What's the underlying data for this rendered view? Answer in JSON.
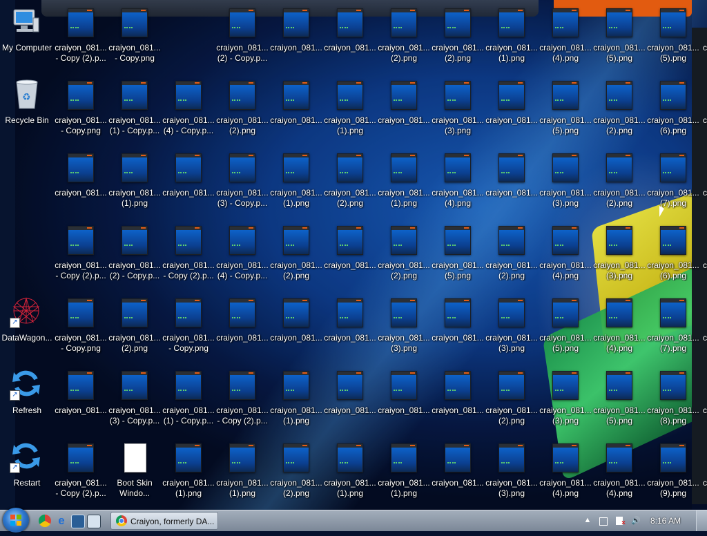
{
  "system_icons": [
    {
      "label": "My Computer"
    },
    {
      "label": "Recycle Bin"
    },
    {
      "label": "DataWagon..."
    },
    {
      "label": "Refresh"
    },
    {
      "label": "Restart"
    }
  ],
  "file_grid": [
    [
      [
        "craiyon_081...",
        "- Copy (2).p..."
      ],
      [
        "craiyon_081...",
        "- Copy.png"
      ],
      null,
      [
        "craiyon_081...",
        "(2) - Copy.p..."
      ],
      [
        "craiyon_081..."
      ],
      [
        "craiyon_081..."
      ],
      [
        "craiyon_081...",
        "(2).png"
      ],
      [
        "craiyon_081...",
        "(2).png"
      ],
      [
        "craiyon_081...",
        "(1).png"
      ],
      [
        "craiyon_081...",
        "(4).png"
      ],
      [
        "craiyon_081...",
        "(5).png"
      ],
      [
        "craiyon_081...",
        "(5).png"
      ]
    ],
    [
      [
        "craiyon_081...",
        "- Copy.png"
      ],
      [
        "craiyon_081...",
        "(1) - Copy.p..."
      ],
      [
        "craiyon_081...",
        "(4) - Copy.p..."
      ],
      [
        "craiyon_081...",
        "(2).png"
      ],
      [
        "craiyon_081..."
      ],
      [
        "craiyon_081...",
        "(1).png"
      ],
      [
        "craiyon_081..."
      ],
      [
        "craiyon_081...",
        "(3).png"
      ],
      [
        "craiyon_081..."
      ],
      [
        "craiyon_081...",
        "(5).png"
      ],
      [
        "craiyon_081...",
        "(2).png"
      ],
      [
        "craiyon_081...",
        "(6).png"
      ]
    ],
    [
      [
        "craiyon_081..."
      ],
      [
        "craiyon_081...",
        "(1).png"
      ],
      [
        "craiyon_081..."
      ],
      [
        "craiyon_081...",
        "(3) - Copy.p..."
      ],
      [
        "craiyon_081...",
        "(1).png"
      ],
      [
        "craiyon_081...",
        "(2).png"
      ],
      [
        "craiyon_081...",
        "(1).png"
      ],
      [
        "craiyon_081...",
        "(4).png"
      ],
      [
        "craiyon_081..."
      ],
      [
        "craiyon_081...",
        "(3).png"
      ],
      [
        "craiyon_081...",
        "(2).png"
      ],
      [
        "craiyon_081...",
        "(7).png"
      ]
    ],
    [
      [
        "craiyon_081...",
        "- Copy (2).p..."
      ],
      [
        "craiyon_081...",
        "(2) - Copy.p..."
      ],
      [
        "craiyon_081...",
        "- Copy (2).p..."
      ],
      [
        "craiyon_081...",
        "(4) - Copy.p..."
      ],
      [
        "craiyon_081...",
        "(2).png"
      ],
      [
        "craiyon_081..."
      ],
      [
        "craiyon_081...",
        "(2).png"
      ],
      [
        "craiyon_081...",
        "(5).png"
      ],
      [
        "craiyon_081...",
        "(2).png"
      ],
      [
        "craiyon_081...",
        "(4).png"
      ],
      [
        "craiyon_081...",
        "(3).png"
      ],
      [
        "craiyon_081...",
        "(6).png"
      ]
    ],
    [
      [
        "craiyon_081...",
        "- Copy.png"
      ],
      [
        "craiyon_081...",
        "(2).png"
      ],
      [
        "craiyon_081...",
        "- Copy.png"
      ],
      [
        "craiyon_081..."
      ],
      [
        "craiyon_081..."
      ],
      [
        "craiyon_081..."
      ],
      [
        "craiyon_081...",
        "(3).png"
      ],
      [
        "craiyon_081..."
      ],
      [
        "craiyon_081...",
        "(3).png"
      ],
      [
        "craiyon_081...",
        "(5).png"
      ],
      [
        "craiyon_081...",
        "(4).png"
      ],
      [
        "craiyon_081...",
        "(7).png"
      ]
    ],
    [
      [
        "craiyon_081..."
      ],
      [
        "craiyon_081...",
        "(3) - Copy.p..."
      ],
      [
        "craiyon_081...",
        "(1) - Copy.p..."
      ],
      [
        "craiyon_081...",
        "- Copy (2).p..."
      ],
      [
        "craiyon_081...",
        "(1).png"
      ],
      [
        "craiyon_081..."
      ],
      [
        "craiyon_081..."
      ],
      [
        "craiyon_081..."
      ],
      [
        "craiyon_081...",
        "(2).png"
      ],
      [
        "craiyon_081...",
        "(3).png"
      ],
      [
        "craiyon_081...",
        "(5).png"
      ],
      [
        "craiyon_081...",
        "(8).png"
      ]
    ],
    [
      [
        "craiyon_081...",
        "- Copy (2).p..."
      ],
      [
        "Boot Skin",
        "Windo..."
      ],
      [
        "craiyon_081...",
        "(1).png"
      ],
      [
        "craiyon_081...",
        "(1).png"
      ],
      [
        "craiyon_081...",
        "(2).png"
      ],
      [
        "craiyon_081...",
        "(1).png"
      ],
      [
        "craiyon_081...",
        "(1).png"
      ],
      [
        "craiyon_081..."
      ],
      [
        "craiyon_081...",
        "(3).png"
      ],
      [
        "craiyon_081...",
        "(4).png"
      ],
      [
        "craiyon_081...",
        "(4).png"
      ],
      [
        "craiyon_081...",
        "(9).png"
      ]
    ]
  ],
  "right_edge_labels": [
    "c",
    "c",
    "c",
    "c",
    "c",
    "c",
    "c"
  ],
  "taskbar": {
    "active_window": "Craiyon, formerly DA...",
    "clock": "8:16 AM"
  }
}
